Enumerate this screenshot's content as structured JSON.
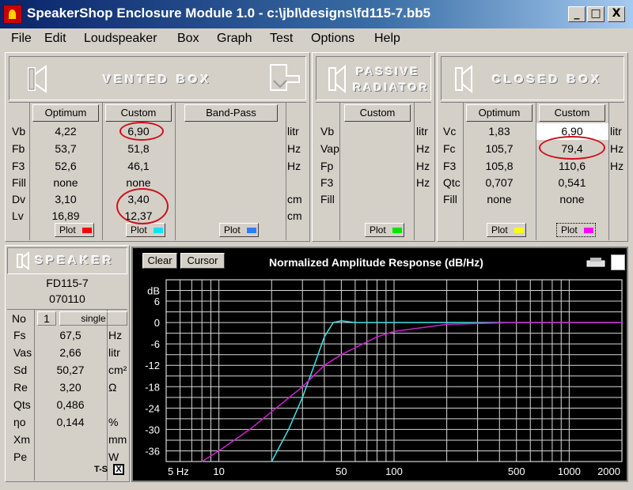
{
  "window": {
    "title": "SpeakerShop Enclosure Module 1.0 - c:\\jbl\\designs\\fd115-7.bb5",
    "min": "_",
    "max": "□",
    "close": "X"
  },
  "menu": [
    "File",
    "Edit",
    "Loudspeaker",
    "Box",
    "Graph",
    "Test",
    "Options",
    "Help"
  ],
  "vented": {
    "header": "VENTED BOX",
    "btn_optimum": "Optimum",
    "btn_custom": "Custom",
    "btn_bandpass": "Band-Pass",
    "rows": [
      {
        "label": "Vb",
        "optimum": "4,22",
        "custom": "6,90",
        "unit": "litr"
      },
      {
        "label": "Fb",
        "optimum": "53,7",
        "custom": "51,8",
        "unit": "Hz"
      },
      {
        "label": "F3",
        "optimum": "52,6",
        "custom": "46,1",
        "unit": "Hz"
      },
      {
        "label": "Fill",
        "optimum": "none",
        "custom": "none",
        "unit": ""
      },
      {
        "label": "Dv",
        "optimum": "3,10",
        "custom": "3,40",
        "unit": "cm"
      },
      {
        "label": "Lv",
        "optimum": "16,89",
        "custom": "12,37",
        "unit": "cm"
      }
    ],
    "plot": "Plot",
    "colors": [
      "#ff0000",
      "#00e5ff",
      "#2a7fff"
    ]
  },
  "passive": {
    "header1": "PASSIVE",
    "header2": "RADIATOR",
    "btn_custom": "Custom",
    "rows": [
      {
        "label": "Vb",
        "unit": "litr"
      },
      {
        "label": "Vap",
        "unit": "Hz"
      },
      {
        "label": "Fp",
        "unit": "Hz"
      },
      {
        "label": "F3",
        "unit": "Hz"
      },
      {
        "label": "Fill",
        "unit": ""
      }
    ],
    "plot": "Plot",
    "color": "#00e600"
  },
  "closed": {
    "header": "CLOSED BOX",
    "btn_optimum": "Optimum",
    "btn_custom": "Custom",
    "rows": [
      {
        "label": "Vc",
        "optimum": "1,83",
        "custom": "6,90",
        "unit": "litr"
      },
      {
        "label": "Fc",
        "optimum": "105,7",
        "custom": "79,4",
        "unit": "Hz"
      },
      {
        "label": "F3",
        "optimum": "105,8",
        "custom": "110,6",
        "unit": "Hz"
      },
      {
        "label": "Qtc",
        "optimum": "0,707",
        "custom": "0,541",
        "unit": ""
      },
      {
        "label": "Fill",
        "optimum": "none",
        "custom": "none",
        "unit": ""
      }
    ],
    "plot": "Plot",
    "plot2": "Plot",
    "colors": [
      "#ffff00",
      "#ff00ff"
    ]
  },
  "speaker": {
    "header": "SPEAKER",
    "model": "FD115-7",
    "code": "070110",
    "no_label": "No",
    "no_value": "1",
    "mode": "single",
    "rows": [
      {
        "label": "Fs",
        "value": "67,5",
        "unit": "Hz"
      },
      {
        "label": "Vas",
        "value": "2,66",
        "unit": "litr"
      },
      {
        "label": "Sd",
        "value": "50,27",
        "unit": "cm²"
      },
      {
        "label": "Re",
        "value": "3,20",
        "unit": "Ω"
      },
      {
        "label": "Qts",
        "value": "0,486",
        "unit": ""
      },
      {
        "label": "ηo",
        "value": "0,144",
        "unit": "%"
      },
      {
        "label": "Xm",
        "value": "",
        "unit": "mm"
      },
      {
        "label": "Pe",
        "value": "",
        "unit": "W"
      }
    ],
    "ts_label": "T-S",
    "ts_checked": "X"
  },
  "graph": {
    "btn_clear": "Clear",
    "btn_cursor": "Cursor",
    "title": "Normalized Amplitude Response (dB/Hz)",
    "ylabels": [
      "dB",
      "6",
      "0",
      "-6",
      "-12",
      "-18",
      "-24",
      "-30",
      "-36"
    ],
    "xlabels": [
      "5 Hz",
      "10",
      "50",
      "100",
      "500",
      "1000",
      "2000"
    ]
  },
  "chart_data": {
    "type": "line",
    "title": "Normalized Amplitude Response (dB/Hz)",
    "xlabel": "",
    "ylabel": "dB",
    "xscale": "log",
    "xlim": [
      5,
      2000
    ],
    "ylim": [
      -39,
      12
    ],
    "grid": true,
    "series": [
      {
        "color": "#40e0e0",
        "x": [
          20,
          25,
          30,
          35,
          40,
          45,
          50,
          60,
          100,
          200,
          500,
          2000
        ],
        "y": [
          -39,
          -30,
          -21,
          -12,
          -4,
          0,
          0.5,
          0,
          0,
          0,
          0,
          0
        ]
      },
      {
        "color": "#d020d0",
        "x": [
          8,
          10,
          15,
          20,
          30,
          40,
          50,
          80,
          100,
          200,
          500,
          1000,
          2000
        ],
        "y": [
          -39,
          -36,
          -30,
          -25,
          -18,
          -12,
          -9,
          -4,
          -2.5,
          -0.5,
          0,
          0,
          0
        ]
      }
    ]
  }
}
